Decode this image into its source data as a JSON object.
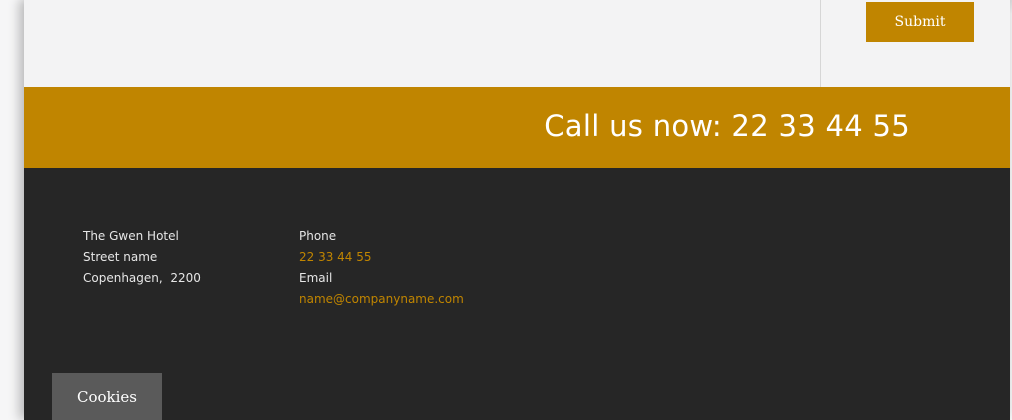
{
  "form": {
    "submit_label": "Submit"
  },
  "call_bar": {
    "text": "Call us now: 22 33 44 55"
  },
  "footer": {
    "address": {
      "line1": "The Gwen Hotel",
      "line2": "Street name",
      "line3": "Copenhagen,  2200"
    },
    "contact": {
      "phone_label": "Phone",
      "phone_value": "22 33 44 55",
      "email_label": "Email",
      "email_value": "name@companyname.com"
    }
  },
  "cookies": {
    "label": "Cookies"
  },
  "colors": {
    "accent": "#c08500",
    "footer_bg": "#262626",
    "cookies_bg": "#5a5a5a"
  }
}
